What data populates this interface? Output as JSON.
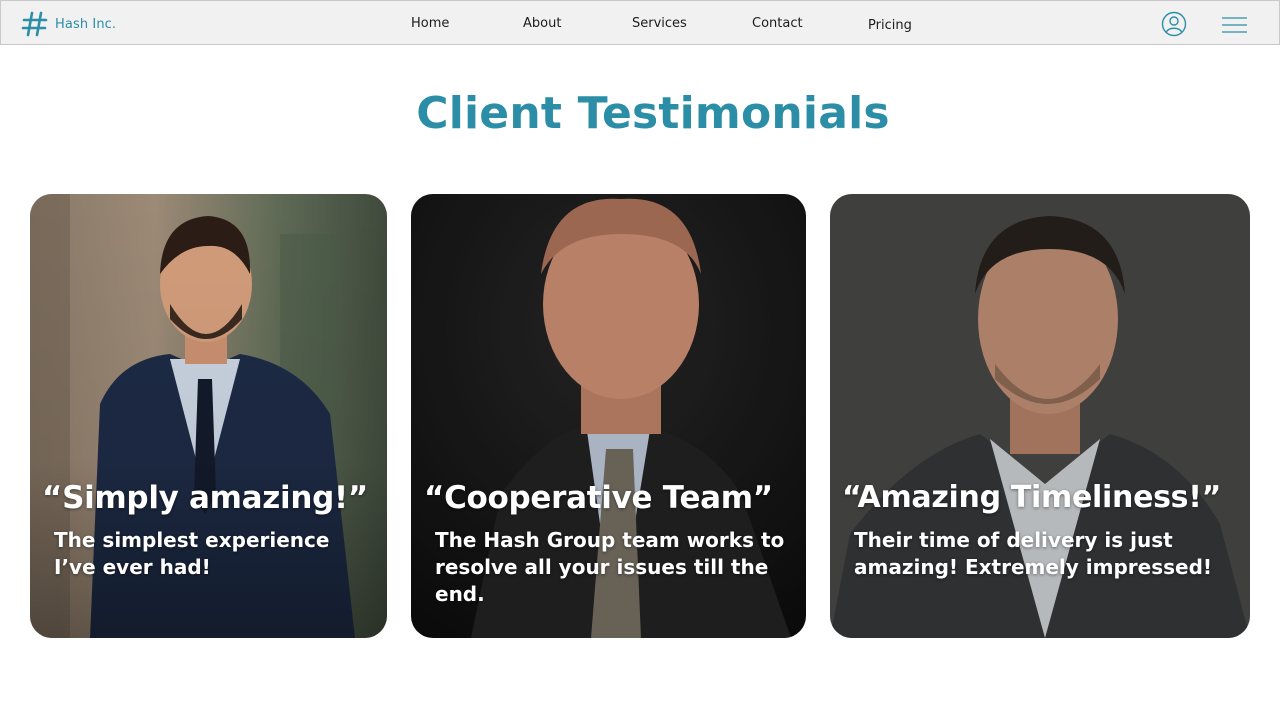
{
  "navbar": {
    "brand": "Hash Inc.",
    "links": [
      "Home",
      "About",
      "Services",
      "Contact",
      "Pricing"
    ],
    "icons": [
      "hash-logo-icon",
      "user-profile-icon",
      "hamburger-menu-icon"
    ]
  },
  "section": {
    "title": "Client Testimonials"
  },
  "testimonials": [
    {
      "quote": "“Simply amazing!”",
      "body": "The simplest experience I’ve ever had!"
    },
    {
      "quote": "“Cooperative Team”",
      "body": "The Hash Group team works to resolve all your issues till the end."
    },
    {
      "quote": "“Amazing Timeliness!”",
      "body": "Their time of delivery is just amazing! Extremely impressed!"
    }
  ],
  "colors": {
    "accent": "#2b8ea6",
    "nav_bg": "#f1f1f1",
    "text": "#1c1c1c"
  }
}
